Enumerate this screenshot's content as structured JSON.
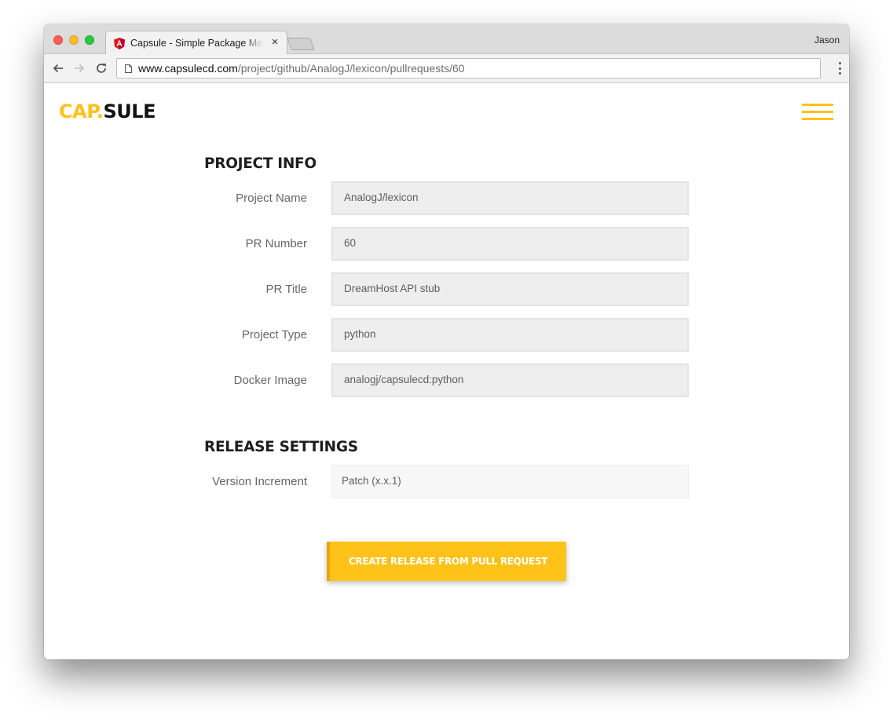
{
  "browser": {
    "tab_title": "Capsule - Simple Package Manager",
    "tab_close": "×",
    "profile_name": "Jason",
    "url_host": "www.capsulecd.com",
    "url_path": "/project/github/AnalogJ/lexicon/pullrequests/60",
    "icons": {
      "favicon": "angular-icon",
      "back": "arrow-left-icon",
      "forward": "arrow-right-icon",
      "reload": "reload-icon",
      "page": "page-icon",
      "menu": "more-vertical-icon"
    }
  },
  "header": {
    "logo_cap": "CAP.",
    "logo_sule": "SULE",
    "menu_icon": "hamburger-icon"
  },
  "project_info": {
    "title": "PROJECT INFO",
    "fields": [
      {
        "label": "Project Name",
        "value": "AnalogJ/lexicon"
      },
      {
        "label": "PR Number",
        "value": "60"
      },
      {
        "label": "PR Title",
        "value": "DreamHost API stub"
      },
      {
        "label": "Project Type",
        "value": "python"
      },
      {
        "label": "Docker Image",
        "value": "analogj/capsulecd:python"
      }
    ]
  },
  "release_settings": {
    "title": "RELEASE SETTINGS",
    "version_label": "Version Increment",
    "version_value": "Patch (x.x.1)"
  },
  "actions": {
    "create_release_label": "CREATE RELEASE FROM PULL REQUEST"
  },
  "colors": {
    "brand_yellow": "#fec219",
    "field_bg": "#eeeeee",
    "text_gray": "#666666"
  }
}
